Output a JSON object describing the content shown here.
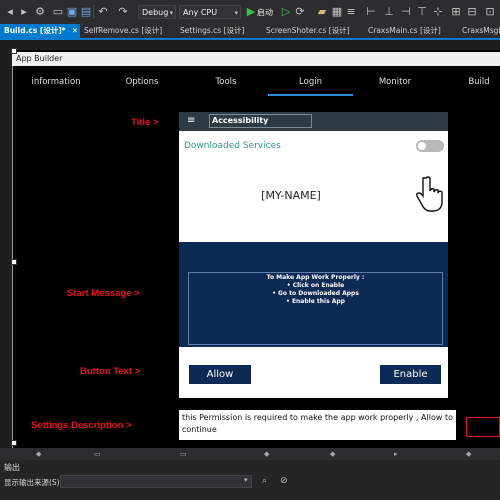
{
  "toolbar": {
    "config": "Debug",
    "platform": "Any CPU",
    "start_label": "启动"
  },
  "doc_tabs": [
    {
      "label": "Build.cs [设计]*",
      "close": "✕"
    },
    {
      "label": "SelfRemove.cs [设计]"
    },
    {
      "label": "Settings.cs [设计]"
    },
    {
      "label": "ScreenShoter.cs [设计]"
    },
    {
      "label": "CraxsMain.cs [设计]"
    },
    {
      "label": "CraxsMsgbox"
    }
  ],
  "form": {
    "title": "App Builder",
    "nav_tabs": [
      "information",
      "Options",
      "Tools",
      "Login",
      "Monitor",
      "Build"
    ],
    "active_tab": "Login"
  },
  "labels": {
    "title": "Title >",
    "start_message": "Start Message >",
    "button_text": "Button Text >",
    "settings_description": "Settings Description >"
  },
  "phone": {
    "header_title": "Accessibility",
    "downloaded_services": "Downloaded Services",
    "my_name": "[MY-NAME]",
    "message_lines": [
      "To Make App Work Properly :",
      "• Click on Enable",
      "• Go to Downloaded Apps",
      "• Enable this App"
    ],
    "allow_button": "Allow",
    "enable_button": "Enable"
  },
  "settings_description_text": "this Permission is required to make the app work properly , Allow to continue",
  "output": {
    "title": "输出",
    "source_label": "显示输出来源(S):"
  },
  "colors": {
    "accent": "#007acc",
    "form_bg": "#000000",
    "label_red": "#e81123",
    "phone_blue": "#0d2a54",
    "teal_text": "#2e9a8c"
  }
}
